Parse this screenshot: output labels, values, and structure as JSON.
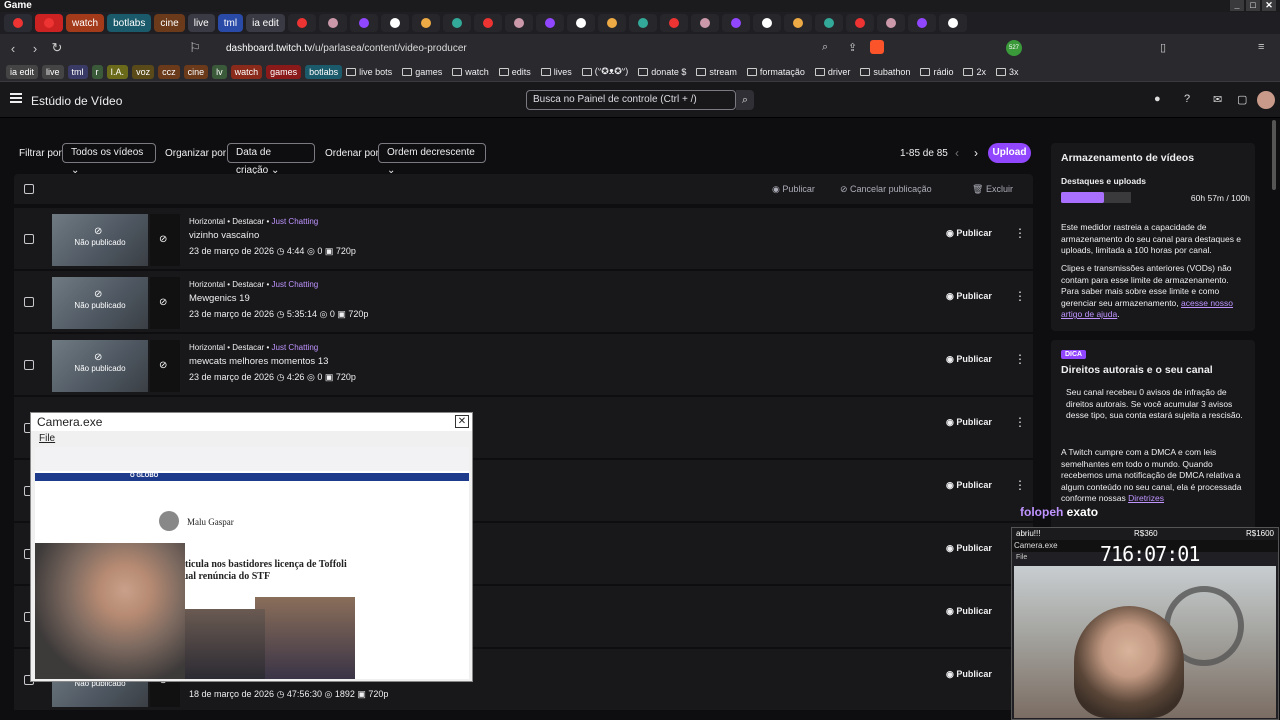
{
  "window": {
    "title": "Game"
  },
  "tabs": [
    {
      "label": "",
      "color": "#2b2b33",
      "icon": "chrome-icon"
    },
    {
      "label": "",
      "color": "#c22",
      "icon": "record-icon"
    },
    {
      "label": "watch",
      "color": "#a33a1a"
    },
    {
      "label": "botlabs",
      "color": "#1a5a6a"
    },
    {
      "label": "cine",
      "color": "#6a3a1a"
    },
    {
      "label": "live",
      "color": "#3a3a44"
    },
    {
      "label": "tml",
      "color": "#2a4aa8"
    },
    {
      "label": "ia edit",
      "color": "#3a3a44"
    }
  ],
  "address": {
    "url_domain": "dashboard.twitch.tv",
    "url_path": "/u/parlasea/content/video-producer",
    "badge_count": "527"
  },
  "bookmarks": {
    "chips": [
      {
        "label": "ia edit",
        "color": "#444"
      },
      {
        "label": "live",
        "color": "#444"
      },
      {
        "label": "tml",
        "color": "#3a3a66"
      },
      {
        "label": "r",
        "color": "#3a5a3a"
      },
      {
        "label": "I.A.",
        "color": "#6a6a1a"
      },
      {
        "label": "voz",
        "color": "#5a4a1a"
      },
      {
        "label": "ccz",
        "color": "#6a3a1a"
      },
      {
        "label": "cine",
        "color": "#6a3a1a"
      },
      {
        "label": "lv",
        "color": "#3a5a3a"
      },
      {
        "label": "watch",
        "color": "#8a2a1a"
      },
      {
        "label": "games",
        "color": "#8a1a1a"
      },
      {
        "label": "botlabs",
        "color": "#1a5a6a"
      }
    ],
    "folders": [
      "live bots",
      "games",
      "watch",
      "edits",
      "lives",
      "(ᐡ✪ᴥ✪ᐡ)",
      "donate $",
      "stream",
      "formatação",
      "driver",
      "subathon",
      "rádio",
      "2x",
      "3x"
    ]
  },
  "header": {
    "page_title": "Estúdio de Vídeo",
    "search_placeholder": "Busca no Painel de controle (Ctrl + /)"
  },
  "filters": {
    "filter_label": "Filtrar por",
    "filter_value": "Todos os vídeos",
    "organize_label": "Organizar por",
    "organize_value": "Data de criação",
    "order_label": "Ordenar por",
    "order_value": "Ordem decrescente",
    "pager": "1-85 de 85",
    "upload": "Upload"
  },
  "bulk_actions": {
    "publish": "Publicar",
    "unpublish": "Cancelar publicação",
    "delete": "Excluir"
  },
  "videos": [
    {
      "meta": "Horizontal • Destacar • ",
      "category": "Just Chatting",
      "title": "vizinho vascaíno",
      "date": "23 de março de 2026",
      "duration": "4:44",
      "views": "0",
      "quality": "720p",
      "status": "Não publicado",
      "action": "Publicar"
    },
    {
      "meta": "Horizontal • Destacar • ",
      "category": "Just Chatting",
      "title": "Mewgenics 19",
      "date": "23 de março de 2026",
      "duration": "5:35:14",
      "views": "0",
      "quality": "720p",
      "status": "Não publicado",
      "action": "Publicar"
    },
    {
      "meta": "Horizontal • Destacar • ",
      "category": "Just Chatting",
      "title": "mewcats melhores momentos 13",
      "date": "23 de março de 2026",
      "duration": "4:26",
      "views": "0",
      "quality": "720p",
      "status": "Não publicado",
      "action": "Publicar"
    },
    {
      "action": "Publicar"
    },
    {
      "action": "Publicar"
    },
    {
      "action": "Publicar"
    },
    {
      "action": "Publicar"
    },
    {
      "date": "18 de março de 2026",
      "duration": "47:56:30",
      "views": "1892",
      "quality": "720p",
      "status": "Não publicado",
      "action": "Publicar"
    }
  ],
  "storage": {
    "title": "Armazenamento de vídeos",
    "subtitle": "Destaques e uploads",
    "usage": "60h 57m / 100h",
    "fill_fraction": 0.61,
    "p1": "Este medidor rastreia a capacidade de armazenamento do seu canal para destaques e uploads, limitada a 100 horas por canal.",
    "p2": "Clipes e transmissões anteriores (VODs) não contam para esse limite de armazenamento. Para saber mais sobre esse limite e como gerenciar seu armazenamento,",
    "p2_link": "acesse nosso artigo de ajuda"
  },
  "tip": {
    "badge": "DICA",
    "title": "Direitos autorais e o seu canal",
    "p1": "Seu canal recebeu 0 avisos de infração de direitos autorais. Se você acumular 3 avisos desse tipo, sua conta estará sujeita a rescisão.",
    "p2": "A Twitch cumpre com a DMCA e com leis semelhantes em todo o mundo. Quando recebemos uma notificação de DMCA relativa a algum conteúdo no seu canal, ela é processada conforme nossas",
    "p2_link": "Diretrizes"
  },
  "camera_window": {
    "title": "Camera.exe",
    "menu": "File",
    "news_author": "Malu Gaspar",
    "news_headline": "Lula articula nos bastidores licença de Toffoli e eventual renúncia do STF",
    "news_site": "O GLOBO"
  },
  "overlay": {
    "chat_user": "folopeh",
    "chat_text": "exato",
    "webcam_title": "Camera.exe",
    "webcam_menu": "File",
    "label_left": "abriu!!!",
    "label_mid": "R$360",
    "label_right": "R$1600",
    "timer": "716:07:01"
  }
}
